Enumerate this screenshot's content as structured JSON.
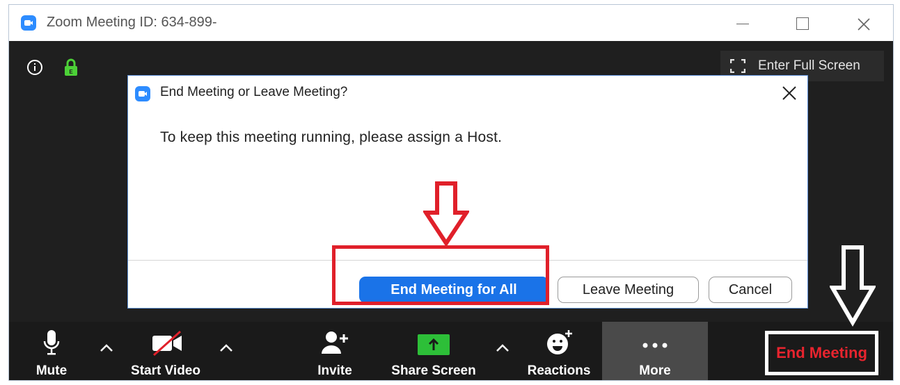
{
  "window": {
    "title": "Zoom Meeting ID: 634-899-"
  },
  "meeting": {
    "fullscreen_label": "Enter Full Screen"
  },
  "dialog": {
    "title": "End Meeting or Leave Meeting?",
    "message": "To keep this meeting running, please assign a Host.",
    "close_glyph": "✕",
    "end_all_label": "End Meeting for All",
    "leave_label": "Leave Meeting",
    "cancel_label": "Cancel"
  },
  "toolbar": {
    "mute_label": "Mute",
    "start_video_label": "Start Video",
    "invite_label": "Invite",
    "share_screen_label": "Share Screen",
    "reactions_label": "Reactions",
    "more_label": "More",
    "end_meeting_label": "End Meeting"
  },
  "colors": {
    "zoom_blue": "#2d8cff",
    "primary_button": "#1a73e8",
    "highlight_red": "#e0202a",
    "end_meeting_red": "#e8242e",
    "lock_green": "#4cd137",
    "share_green": "#2dbf38"
  },
  "icons": {
    "window_logo": "zoom-logo-icon",
    "info": "info-icon",
    "lock": "lock-icon",
    "fullscreen": "fullscreen-icon",
    "microphone": "microphone-icon",
    "video_off": "video-off-icon",
    "invite": "add-person-icon",
    "share": "share-screen-icon",
    "reactions": "smiley-plus-icon",
    "more": "ellipsis-icon",
    "caret": "chevron-up-icon",
    "annotation_arrow": "down-arrow-icon"
  }
}
